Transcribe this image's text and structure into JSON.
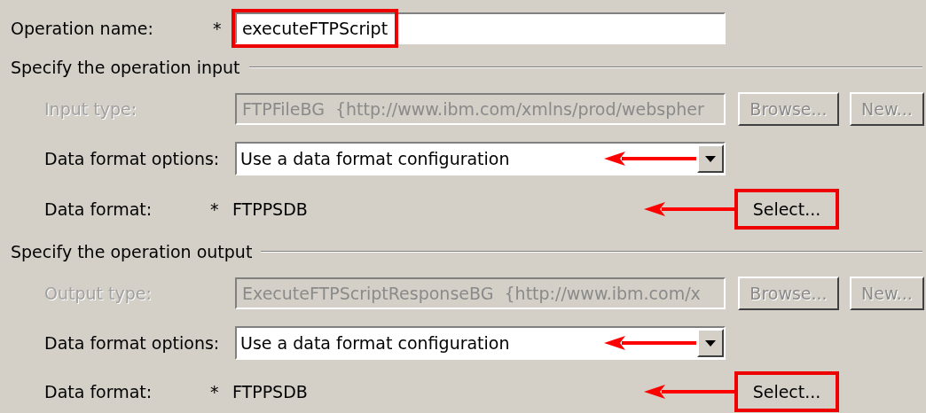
{
  "operation": {
    "label": "Operation name:",
    "required_mark": "*",
    "value": "executeFTPScript",
    "highlighted": true
  },
  "sections": [
    {
      "title": "Specify the operation input",
      "type_field": {
        "label": "Input type:",
        "value": "FTPFileBG  {http://www.ibm.com/xmlns/prod/webspher",
        "disabled": true
      },
      "type_buttons": [
        {
          "label": "Browse...",
          "disabled": true
        },
        {
          "label": "New...",
          "disabled": true
        }
      ],
      "format_options": {
        "label": "Data format options:",
        "value": "Use a data format configuration",
        "arrow": true
      },
      "data_format": {
        "label": "Data format:",
        "required_mark": "*",
        "value": "FTPPSDB",
        "arrow": true
      },
      "select_button": {
        "label": "Select...",
        "highlighted": true
      }
    },
    {
      "title": "Specify the operation output",
      "type_field": {
        "label": "Output type:",
        "value": "ExecuteFTPScriptResponseBG  {http://www.ibm.com/x",
        "disabled": true
      },
      "type_buttons": [
        {
          "label": "Browse...",
          "disabled": true
        },
        {
          "label": "New...",
          "disabled": true
        }
      ],
      "format_options": {
        "label": "Data format options:",
        "value": "Use a data format configuration",
        "arrow": true
      },
      "data_format": {
        "label": "Data format:",
        "required_mark": "*",
        "value": "FTPPSDB",
        "arrow": true
      },
      "select_button": {
        "label": "Select...",
        "highlighted": true
      }
    }
  ]
}
